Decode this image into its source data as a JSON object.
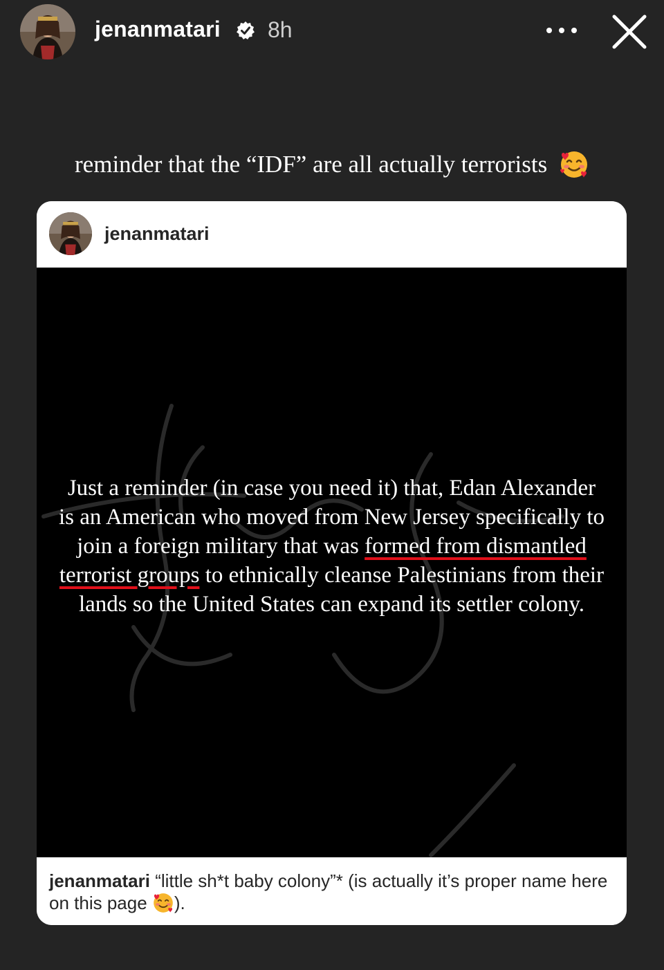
{
  "header": {
    "username": "jenanmatari",
    "time": "8h",
    "avatar_icon": "profile-photo",
    "verified_icon": "verified-badge-icon",
    "more_icon": "more-options-icon",
    "close_icon": "close-icon"
  },
  "caption": {
    "text": "reminder that the “IDF” are all actually terrorists",
    "emoji": "smiling-face-with-hearts"
  },
  "post": {
    "username": "jenanmatari",
    "body_before": "Just a reminder (in case you need it) that, Edan Alexander is an American who moved from New Jersey specifically to join a foreign military that was ",
    "body_underlined": "formed from dismantled terrorist groups",
    "body_after": " to ethnically cleanse Palestinians from their lands so the United States can expand its settler colony.",
    "footer_username": "jenanmatari",
    "footer_text_before": "“little sh*t baby colony”* (is actually it’s proper name here on this page ",
    "footer_text_after": ").",
    "footer_emoji": "smiling-face-with-hearts"
  },
  "colors": {
    "background": "#242424",
    "underline": "#e0101a",
    "post_background": "#000000",
    "card_background": "#ffffff"
  }
}
